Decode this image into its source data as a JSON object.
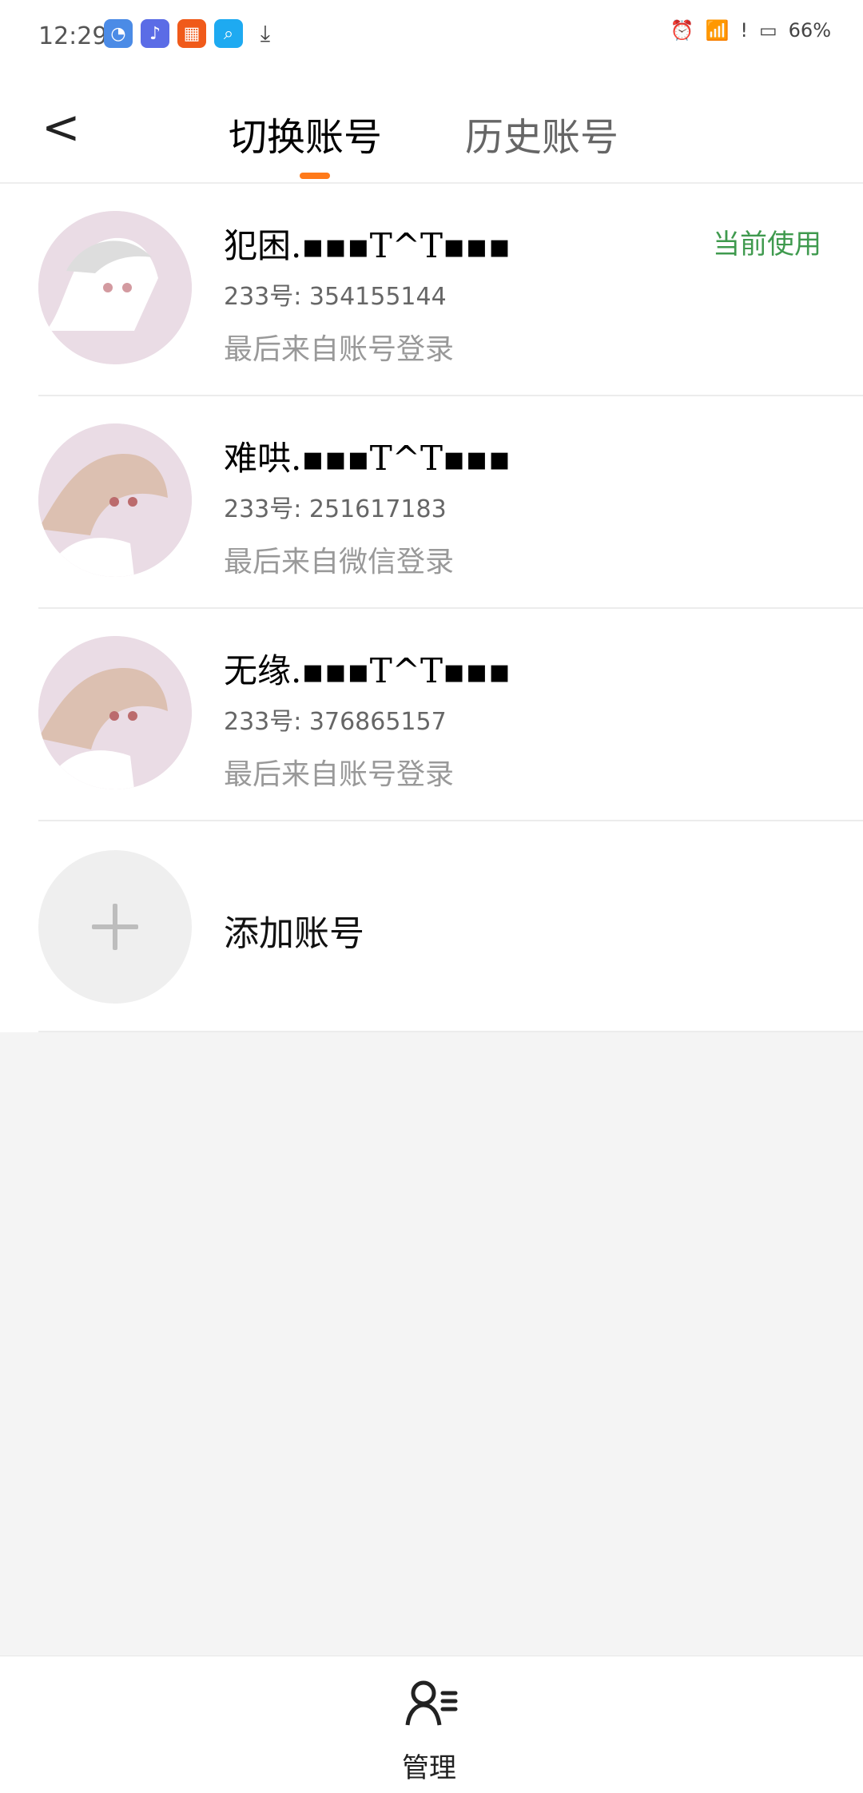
{
  "status_bar": {
    "time": "12:29",
    "battery": "66%"
  },
  "header": {
    "tabs": [
      "切换账号",
      "历史账号"
    ],
    "back": "<"
  },
  "accounts": [
    {
      "name": "犯困.▪︎▪︎▪︎T^T▪︎▪︎▪︎",
      "id": "233号: 354155144",
      "login": "最后来自账号登录",
      "current": "当前使用"
    },
    {
      "name": "难哄.▪︎▪︎▪︎T^T▪︎▪︎▪︎",
      "id": "233号: 251617183",
      "login": "最后来自微信登录"
    },
    {
      "name": "无缘.▪︎▪︎▪︎T^T▪︎▪︎▪︎",
      "id": "233号: 376865157",
      "login": "最后来自账号登录"
    }
  ],
  "add_account": "添加账号",
  "bottom": {
    "label": "管理"
  }
}
